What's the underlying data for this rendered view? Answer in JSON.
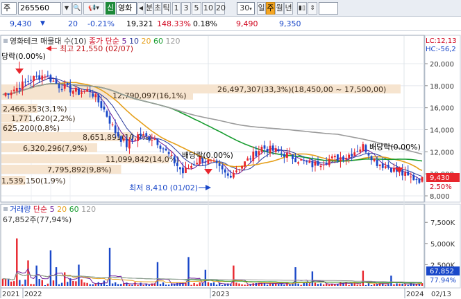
{
  "toolbar": {
    "market": "주",
    "code": "265560",
    "stock_name": "영화",
    "badge": "신",
    "period_labels": [
      "분",
      "초",
      "틱",
      "1",
      "3",
      "5",
      "10",
      "20",
      "30"
    ],
    "selected_interval": "30",
    "timeframes": [
      "일",
      "주",
      "월",
      "년"
    ],
    "active_timeframe": "주"
  },
  "quote": {
    "price": "9,430",
    "change": "20",
    "rate": "-0.21%",
    "volume": "19,321",
    "vol_ratio": "148.33%",
    "turnover": "0.18%",
    "high": "9,490",
    "low": "9,350"
  },
  "colors": {
    "up": "#e8262d",
    "down": "#1a48c9",
    "ma5": "#6f1f9a",
    "ma10": "#2a3b9c",
    "ma20": "#e6a01b",
    "ma60": "#169c2e",
    "ma120": "#9a9a9a",
    "band": "#f6e4cf"
  },
  "price_panel": {
    "legend_title": "영화테크 매물대 수(10)",
    "legend_type": "종가 단순",
    "ma_periods": [
      "5",
      "10",
      "20",
      "60",
      "120"
    ],
    "lc_label": "LC:12,13",
    "hc_label": "HC:-56,2",
    "axis_ticks": [
      "20,000",
      "18,000",
      "16,000",
      "14,000",
      "12,000",
      "10,000",
      "8,000"
    ],
    "current_price_tag": "9,430",
    "current_pct_tag": "2.50%",
    "annotations": {
      "high": "최고 21,550 (02/07)",
      "low": "최저 8,410 (01/02)",
      "ex_div_1": "당락(0.00%)",
      "ex_div_2": "배당락(0.00%)",
      "ex_div_3": "배당락(0.00%)"
    }
  },
  "volume_profile": [
    {
      "label": "26,497,307(33,3%)(18,450,00 ~ 17,500,00)",
      "ratio": 1.0
    },
    {
      "label": "12,790,097(16,1%)",
      "ratio": 0.48
    },
    {
      "label": "2,466,353(3,1%)",
      "ratio": 0.09
    },
    {
      "label": "1,771,620(2,2%)",
      "ratio": 0.07
    },
    {
      "label": "625,200(0,8%)",
      "ratio": 0.03
    },
    {
      "label": "8,651,891(10,9%)",
      "ratio": 0.33
    },
    {
      "label": "6,320,296(7,9%)",
      "ratio": 0.24
    },
    {
      "label": "11,099,842(14,0%)",
      "ratio": 0.42
    },
    {
      "label": "7,795,892(9,8%)",
      "ratio": 0.3
    },
    {
      "label": "1,539,150(1,9%)",
      "ratio": 0.06
    }
  ],
  "volume_panel": {
    "legend_title": "거래량",
    "legend_type": "단순",
    "ma_periods": [
      "5",
      "20",
      "60",
      "120"
    ],
    "last_label": "67,852주(77,94%)",
    "axis_ticks": [
      "7,500K",
      "5,000K",
      "2,500K"
    ],
    "current_tag": "67,852",
    "pct_tag": "77.94%"
  },
  "x_axis": {
    "labels": [
      "2021",
      "2022",
      "2023",
      "2024"
    ],
    "date_tag": "02/13"
  }
}
